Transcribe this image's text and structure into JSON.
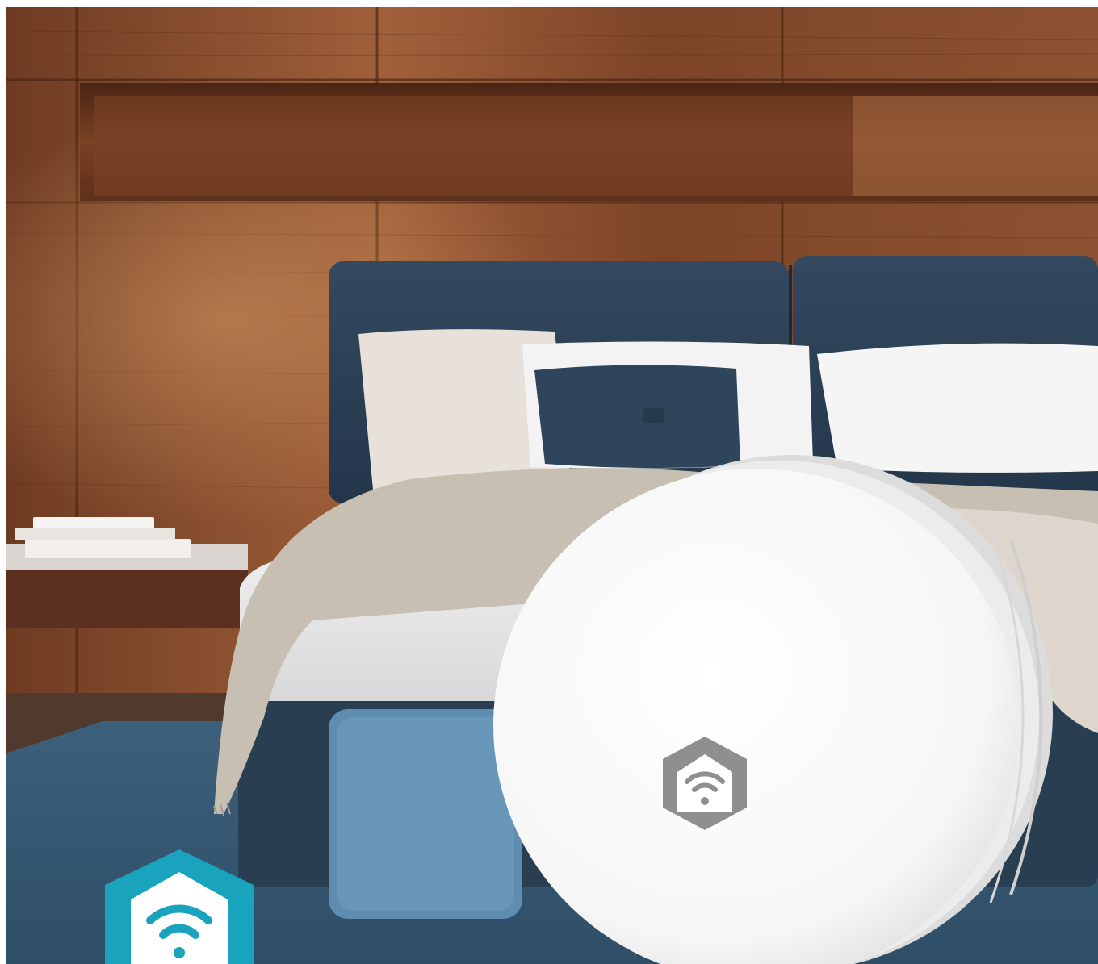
{
  "scene": {
    "subject": "smart-home-wifi-device-in-bedroom",
    "colors": {
      "wood_dark": "#6b3a22",
      "wood_mid": "#8a4d2e",
      "wood_light": "#b06a3e",
      "headboard": "#2c4157",
      "headboard_dark": "#1f2f40",
      "pillow_light": "#e9e4de",
      "pillow_white": "#f4f4f4",
      "pillow_blue": "#34495f",
      "sheet": "#e7e7e8",
      "throw": "#c9c0b4",
      "rug": "#365670",
      "device": "#fbfbfb",
      "device_logo": "#8f8f8f",
      "logo_badge": "#1aa3bd"
    },
    "icons": {
      "device_logo": "wifi-house-icon",
      "corner_badge": "wifi-house-badge-icon"
    }
  }
}
